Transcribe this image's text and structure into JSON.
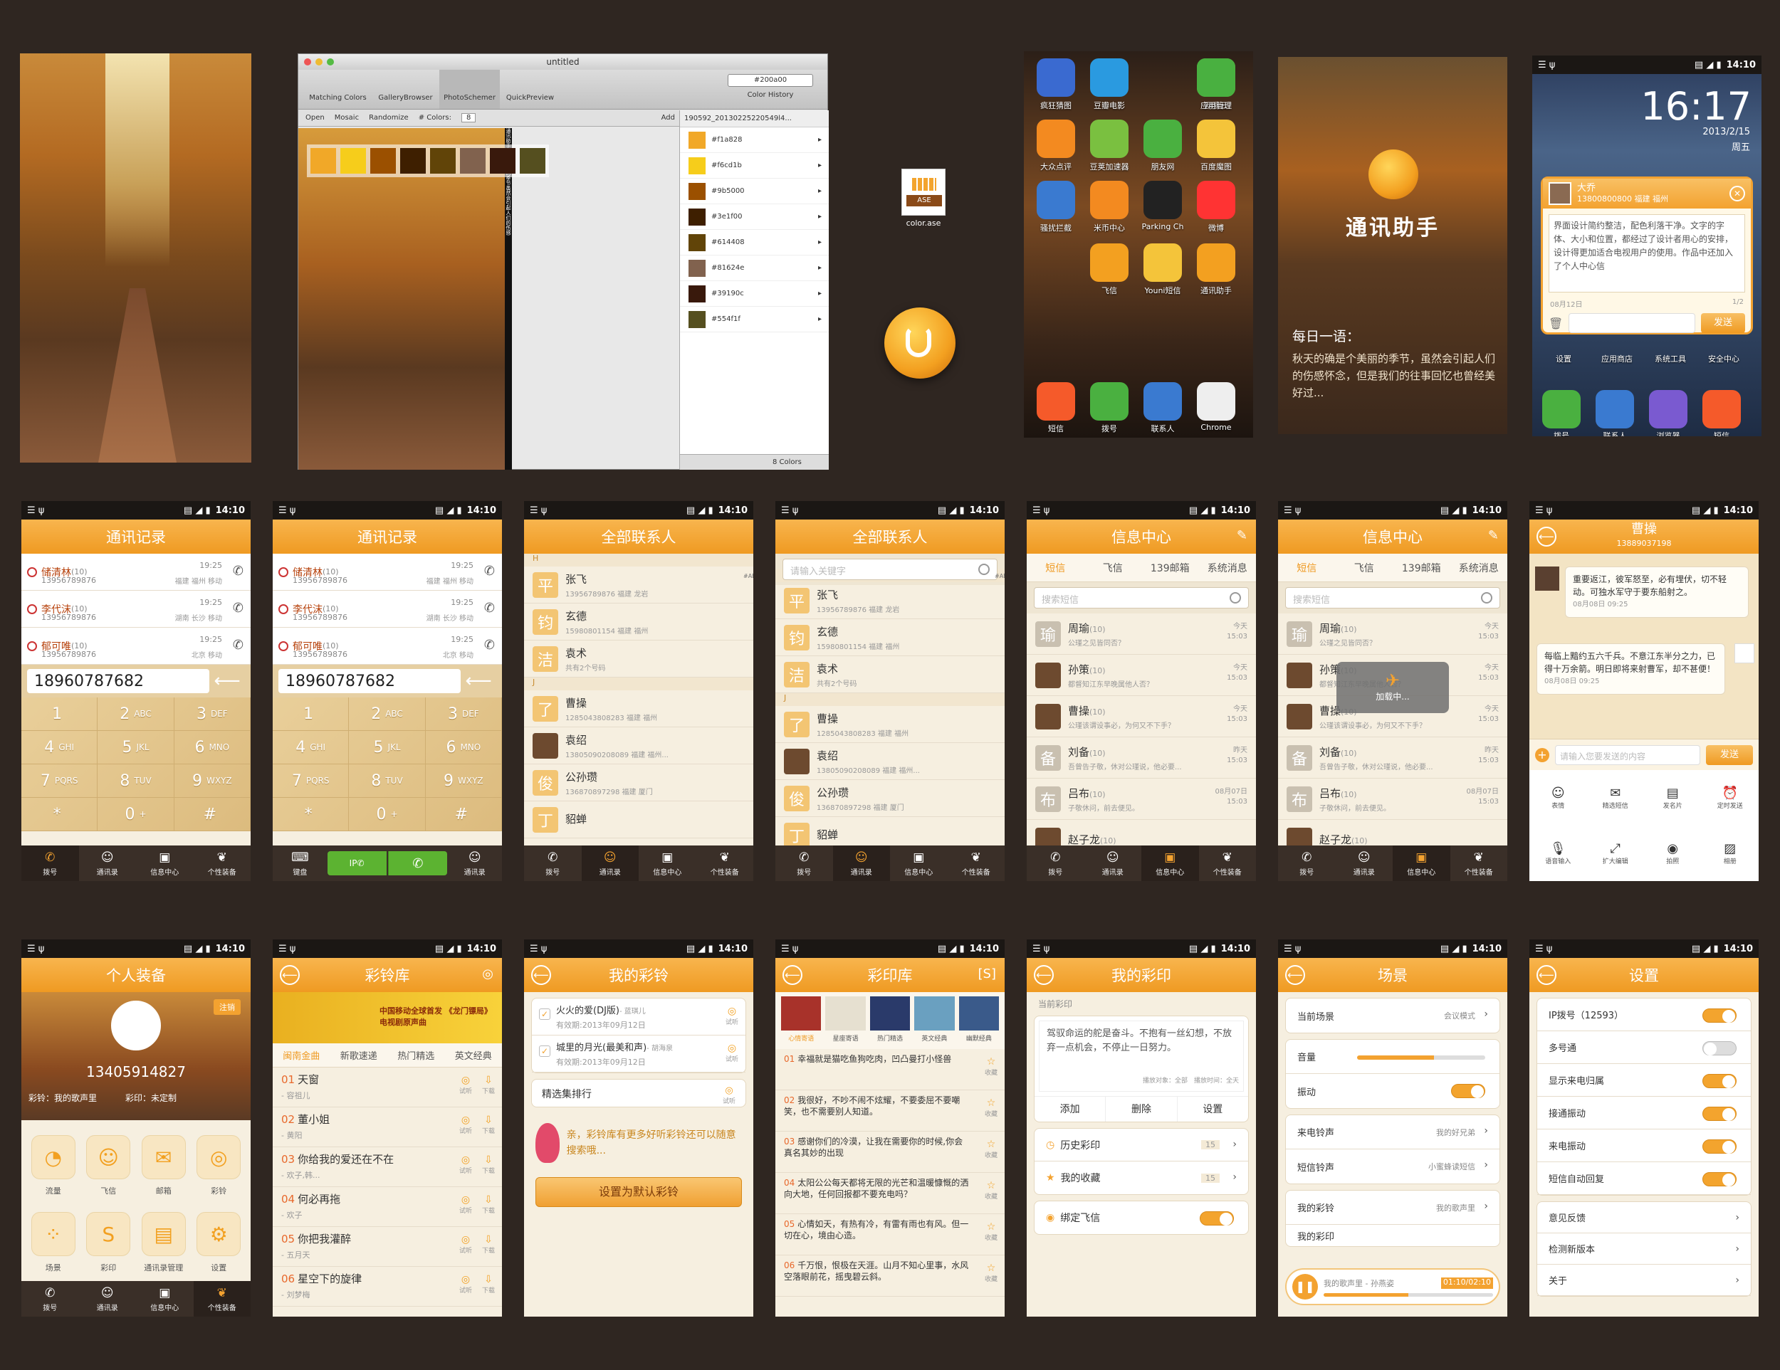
{
  "mac": {
    "title": "untitled",
    "tb": [
      "Matching Colors",
      "GalleryBrowser",
      "PhotoSchemer",
      "QuickPreview"
    ],
    "hexsel": "#200a00",
    "hist": "Color History",
    "open": "Open",
    "mosaic": "Mosaic",
    "rand": "Randomize",
    "ncolors": "# Colors:",
    "nval": "8",
    "add": "Add",
    "file": "190592_20130225220549l4...",
    "colors": [
      "#f1a828",
      "#f6cd1b",
      "#9b5000",
      "#3e1f00",
      "#614408",
      "#81624e",
      "#39190c",
      "#554f1f"
    ],
    "count": "8 Colors",
    "vtext": "通讯助手_迎来美丽的季节虽然会引起人们的伤感"
  },
  "ase": {
    "tag": "ASE",
    "name": "color.ase"
  },
  "home": {
    "apps": [
      "疯狂猜图",
      "豆瓣电影",
      "网易云",
      "应用管理",
      "大众点评",
      "豆荚加速器",
      "朋友网",
      "百度魔图",
      "骚扰拦截",
      "米币中心",
      "Parking Ch",
      "微博",
      "飞信",
      "Youni短信",
      "通讯助手"
    ],
    "dock": [
      "短信",
      "拨号",
      "联系人",
      "Chrome"
    ]
  },
  "splash": {
    "title": "通讯助手",
    "quote_h": "每日一语：",
    "quote": "秋天的确是个美丽的季节，虽然会引起人们的伤感怀念，但是我们的往事回忆也曾经美好过..."
  },
  "lock": {
    "time": "16:17",
    "date": "2013/2/15",
    "week": "周五",
    "name": "大乔",
    "num": "13800800800",
    "loc": "福建 福州",
    "msg": "界面设计简约整洁，配色利落干净。文字的字体、大小和位置，都经过了设计者用心的安排，设计得更加适合电视用户的使用。作品中还加入了个人中心信",
    "date2": "08月12日",
    "page": "1/2",
    "send": "发送",
    "apps": [
      "设置",
      "应用商店",
      "系统工具",
      "安全中心"
    ],
    "dock": [
      "拨号",
      "联系人",
      "浏览器",
      "短信"
    ]
  },
  "sb_time": "14:10",
  "tabs_main": [
    "拨号",
    "通讯录",
    "信息中心",
    "个性装备"
  ],
  "calls": {
    "title": "通讯记录",
    "items": [
      {
        "name": "储清林",
        "badge": "(10)",
        "num": "13956789876",
        "time": "19:25",
        "loc": "福建 福州 移动"
      },
      {
        "name": "李代沫",
        "badge": "(10)",
        "num": "13956789876",
        "time": "19:25",
        "loc": "湖南 长沙 移动"
      },
      {
        "name": "郁可唯",
        "badge": "(10)",
        "num": "13956789876",
        "time": "19:25",
        "loc": "北京 移动"
      }
    ],
    "number": "18960787682",
    "keys": [
      [
        "1",
        ""
      ],
      [
        "2",
        "ABC"
      ],
      [
        "3",
        "DEF"
      ],
      [
        "4",
        "GHI"
      ],
      [
        "5",
        "JKL"
      ],
      [
        "6",
        "MNO"
      ],
      [
        "7",
        "PQRS"
      ],
      [
        "8",
        "TUV"
      ],
      [
        "9",
        "WXYZ"
      ],
      [
        "*",
        ""
      ],
      [
        "0",
        "+"
      ],
      [
        "#",
        ""
      ]
    ],
    "tabs2": [
      "键盘",
      "IP",
      "",
      "通讯录"
    ]
  },
  "contacts": {
    "title": "全部联系人",
    "search": "请输入关键字",
    "items": [
      {
        "sec": "H",
        "av": "平",
        "name": "张飞",
        "sub": "13956789876 福建 龙岩"
      },
      {
        "av": "钧",
        "name": "玄德",
        "sub": "15980801154 福建 福州"
      },
      {
        "av": "洁",
        "name": "袁术",
        "sub": "共有2个号码"
      },
      {
        "sec": "J",
        "av": "了",
        "name": "曹操",
        "sub": "1285043808283 福建 福州"
      },
      {
        "av": "",
        "name": "袁绍",
        "sub": "13805090208089 福建 福州..."
      },
      {
        "av": "俊",
        "name": "公孙瓒",
        "sub": "136870897298 福建 厦门"
      },
      {
        "av": "丁",
        "name": "貂蝉",
        "sub": ""
      }
    ],
    "alpha": "#ABCDEFGHIJKLMNOPQRSTUVWXYZ"
  },
  "msgs": {
    "title": "信息中心",
    "tabs": [
      "短信",
      "飞信",
      "139邮箱",
      "系统消息"
    ],
    "search": "搜索短信",
    "items": [
      {
        "av": "瑜",
        "name": "周瑜",
        "c": "(10)",
        "sub": "公瑾之见皆同否？",
        "t1": "今天",
        "t2": "15:03"
      },
      {
        "av": "",
        "name": "孙策",
        "c": "(10)",
        "sub": "都督知江东早晚属他人否？",
        "t1": "今天",
        "t2": "15:03"
      },
      {
        "av": "",
        "name": "曹操",
        "c": "(10)",
        "sub": "公瑾该谓设事必，为何又不下手？",
        "t1": "今天",
        "t2": "15:03"
      },
      {
        "av": "备",
        "name": "刘备",
        "c": "(10)",
        "sub": "吾曾告子敬，休对公瑾说，他必要...",
        "t1": "昨天",
        "t2": "15:03"
      },
      {
        "av": "布",
        "name": "吕布",
        "c": "(10)",
        "sub": "子敬休问，前去便见。",
        "t1": "08月07日",
        "t2": "15:03"
      },
      {
        "av": "",
        "name": "赵子龙",
        "c": "(10)",
        "sub": "",
        "t1": "",
        "t2": ""
      }
    ],
    "loading": "加载中..."
  },
  "chat": {
    "name": "曹操",
    "num": "13889037198",
    "m1": "重要返江，彼军怒至，必有埋伏，切不轻动。可独水军守于要东船射之。",
    "d1": "08月08日 09:25",
    "m2": "每临上黯约五六千兵。不意江东半分之力，已得十万余箭。明日即将来射曹军，却不甚便！",
    "d2": "08月08日 09:25",
    "ph": "请输入您要发送的内容",
    "send": "发送",
    "tools": [
      "表情",
      "精选短信",
      "发名片",
      "定时发送",
      "语音输入",
      "扩大编辑",
      "拍照",
      "相册"
    ]
  },
  "gear": {
    "title": "个人装备",
    "phone": "13405914827",
    "btn": "注销",
    "ring": "彩铃：我的歌声里",
    "cy": "彩印：未定制",
    "items": [
      "流量",
      "飞信",
      "邮箱",
      "彩铃",
      "场景",
      "彩印",
      "通讯录管理",
      "设置"
    ]
  },
  "ringlib": {
    "title": "彩铃库",
    "tabs": [
      "闽南金曲",
      "新歌速递",
      "热门精选",
      "英文经典"
    ],
    "banner": "中国移动全球首发 《龙门镖局》电视剧原声曲",
    "items": [
      {
        "n": "01",
        "t": "天窗",
        "a": "- 容祖儿"
      },
      {
        "n": "02",
        "t": "董小姐",
        "a": "- 黄阳"
      },
      {
        "n": "03",
        "t": "你给我的爱还在不在",
        "a": "- 欢子,韩..."
      },
      {
        "n": "04",
        "t": "何必再拖",
        "a": "- 欢子"
      },
      {
        "n": "05",
        "t": "你把我灌醉",
        "a": "- 五月天"
      },
      {
        "n": "06",
        "t": "星空下的旋律",
        "a": "- 刘梦梅"
      }
    ],
    "listen": "试听",
    "dl": "下载"
  },
  "myring": {
    "title": "我的彩铃",
    "items": [
      {
        "t": "火火的爱(DJ版)",
        "a": "- 蓝琪儿",
        "e": "有效期:2013年09月12日"
      },
      {
        "t": "城里的月光(最美和声)",
        "a": "- 胡海泉",
        "e": "有效期:2013年09月12日"
      }
    ],
    "pick": "精选集排行",
    "promo": "亲，彩铃库有更多好听彩铃还可以随意搜索哦...",
    "btn": "设置为默认彩铃",
    "listen": "试听"
  },
  "cylib": {
    "title": "彩印库",
    "cats": [
      "心情寄语",
      "星座寄语",
      "热门精选",
      "英文经典",
      "幽默经典"
    ],
    "items": [
      {
        "n": "01",
        "t": "幸福就是猫吃鱼狗吃肉，凹凸曼打小怪兽"
      },
      {
        "n": "02",
        "t": "我很好，不吵不闹不炫耀，不要委屈不要嘲笑，也不需要别人知道。"
      },
      {
        "n": "03",
        "t": "感谢你们的冷漠，让我在需要你的时候,你会真名其妙的出现"
      },
      {
        "n": "04",
        "t": "太阳公公每天都将无限的光芒和温暖慷慨的洒向大地，任何回报都不要充电吗？"
      },
      {
        "n": "05",
        "t": "心情如天，有热有冷，有雷有雨也有风。但一切在心，境由心造。"
      },
      {
        "n": "06",
        "t": "千万恨，恨极在天涯。山月不知心里事，水风空落眼前花，摇曳碧云斜。"
      }
    ],
    "fav": "收藏"
  },
  "mycy": {
    "title": "我的彩印",
    "cur": "当前彩印",
    "text": "驾驭命运的舵是奋斗。不抱有一丝幻想，不放弃一点机会，不停止一日努力。",
    "obj": "播放对象：全部",
    "time": "播放时间：全天",
    "btns": [
      "添加",
      "删除",
      "设置"
    ],
    "hist": "历史彩印",
    "fav": "我的收藏",
    "c1": "15",
    "c2": "15",
    "bind": "绑定飞信"
  },
  "scene": {
    "title": "场景",
    "cur": "当前场景",
    "mode": "会议模式",
    "vol": "音量",
    "vib": "振动",
    "ring": "来电铃声",
    "ringv": "我的好兄弟",
    "sms": "短信铃声",
    "smsv": "小蜜蜂读短信",
    "myr": "我的彩铃",
    "myrv": "我的歌声里",
    "myc": "我的彩印",
    "play": "我的歌声里 - 孙燕姿",
    "tm": "01:10",
    "tt": "02:10"
  },
  "settings": {
    "title": "设置",
    "items": [
      "IP拨号（12593）",
      "多号通",
      "显示来电归属",
      "接通振动",
      "来电振动",
      "短信自动回复",
      "意见反馈",
      "检测新版本",
      "关于"
    ]
  }
}
